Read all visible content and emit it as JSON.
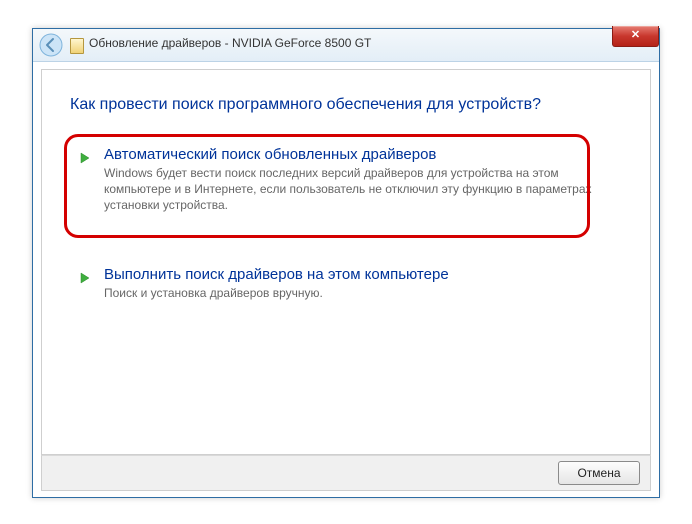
{
  "window": {
    "title": "Обновление драйверов - NVIDIA GeForce 8500 GT"
  },
  "heading": "Как провести поиск программного обеспечения для устройств?",
  "options": [
    {
      "title": "Автоматический поиск обновленных драйверов",
      "desc": "Windows будет вести поиск последних версий драйверов для устройства на этом компьютере и в Интернете, если пользователь не отключил эту функцию в параметрах установки устройства."
    },
    {
      "title": "Выполнить поиск драйверов на этом компьютере",
      "desc": "Поиск и установка драйверов вручную."
    }
  ],
  "footer": {
    "cancel": "Отмена"
  }
}
